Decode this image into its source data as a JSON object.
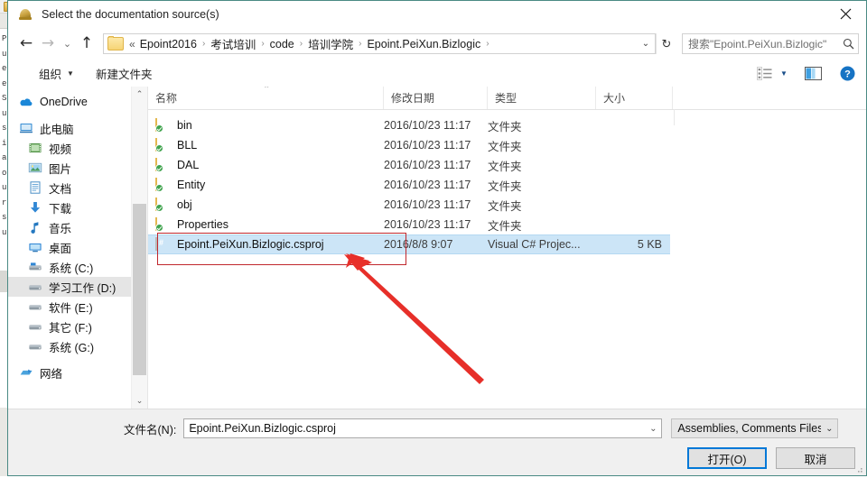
{
  "background_window": {
    "code_fragments": [
      "Pr",
      "ui",
      "el",
      "el",
      "S",
      "ur",
      "si",
      "is",
      "at",
      "or",
      "u",
      "ra",
      "se",
      "ui"
    ]
  },
  "dialog": {
    "title": "Select the documentation source(s)",
    "title_icon": "bell-icon",
    "close_label": "✕"
  },
  "navbar": {
    "back_label": "←",
    "forward_label": "→",
    "recent_label": "⌄",
    "up_label": "↑",
    "address": {
      "folder_icon": "folder-icon",
      "root_label": "«",
      "crumbs": [
        {
          "label": "Epoint2016"
        },
        {
          "label": "考试培训"
        },
        {
          "label": "code"
        },
        {
          "label": "培训学院"
        },
        {
          "label": "Epoint.PeiXun.Bizlogic"
        }
      ],
      "separator": "›",
      "dropdown_label": "⌄",
      "refresh_label": "↻"
    },
    "search": {
      "placeholder": "搜索\"Epoint.PeiXun.Bizlogic\"",
      "icon": "search-icon"
    }
  },
  "toolbar": {
    "organize_label": "组织",
    "organize_caret": "▼",
    "new_folder_label": "新建文件夹",
    "view_icon": "list-view-icon",
    "view_caret": "▼",
    "preview_pane_icon": "preview-pane-icon",
    "help_icon": "help-icon",
    "help_glyph": "?"
  },
  "sidebar": {
    "items": [
      {
        "label": "OneDrive",
        "icon": "onedrive-cloud-icon",
        "indent": false,
        "selected": false
      },
      {
        "label": "此电脑",
        "icon": "this-pc-icon",
        "indent": false,
        "selected": false
      },
      {
        "label": "视频",
        "icon": "videos-icon",
        "indent": true,
        "selected": false
      },
      {
        "label": "图片",
        "icon": "pictures-icon",
        "indent": true,
        "selected": false
      },
      {
        "label": "文档",
        "icon": "documents-icon",
        "indent": true,
        "selected": false
      },
      {
        "label": "下载",
        "icon": "downloads-icon",
        "indent": true,
        "selected": false
      },
      {
        "label": "音乐",
        "icon": "music-icon",
        "indent": true,
        "selected": false
      },
      {
        "label": "桌面",
        "icon": "desktop-icon",
        "indent": true,
        "selected": false
      },
      {
        "label": "系统 (C:)",
        "icon": "drive-system-icon",
        "indent": true,
        "selected": false
      },
      {
        "label": "学习工作 (D:)",
        "icon": "drive-icon",
        "indent": true,
        "selected": true
      },
      {
        "label": "软件 (E:)",
        "icon": "drive-icon",
        "indent": true,
        "selected": false
      },
      {
        "label": "其它 (F:)",
        "icon": "drive-icon",
        "indent": true,
        "selected": false
      },
      {
        "label": "系统 (G:)",
        "icon": "drive-icon",
        "indent": true,
        "selected": false
      },
      {
        "label": "网络",
        "icon": "network-icon",
        "indent": false,
        "selected": false
      }
    ],
    "scroll_up": "⌃",
    "scroll_down": "⌄"
  },
  "filelist": {
    "columns": [
      {
        "key": "name",
        "label": "名称"
      },
      {
        "key": "date",
        "label": "修改日期"
      },
      {
        "key": "type",
        "label": "类型"
      },
      {
        "key": "size",
        "label": "大小"
      }
    ],
    "sort_indicator": "⌃",
    "rows": [
      {
        "name": "bin",
        "date": "2016/10/23 11:17",
        "type": "文件夹",
        "size": "",
        "icon": "folder-icon",
        "selected": false
      },
      {
        "name": "BLL",
        "date": "2016/10/23 11:17",
        "type": "文件夹",
        "size": "",
        "icon": "folder-icon",
        "selected": false
      },
      {
        "name": "DAL",
        "date": "2016/10/23 11:17",
        "type": "文件夹",
        "size": "",
        "icon": "folder-icon",
        "selected": false
      },
      {
        "name": "Entity",
        "date": "2016/10/23 11:17",
        "type": "文件夹",
        "size": "",
        "icon": "folder-icon",
        "selected": false
      },
      {
        "name": "obj",
        "date": "2016/10/23 11:17",
        "type": "文件夹",
        "size": "",
        "icon": "folder-icon",
        "selected": false
      },
      {
        "name": "Properties",
        "date": "2016/10/23 11:17",
        "type": "文件夹",
        "size": "",
        "icon": "folder-icon",
        "selected": false
      },
      {
        "name": "Epoint.PeiXun.Bizlogic.csproj",
        "date": "2016/8/8 9:07",
        "type": "Visual C# Projec...",
        "size": "5 KB",
        "icon": "csproj-icon",
        "selected": true
      }
    ]
  },
  "bottom": {
    "filename_label": "文件名(N):",
    "filename_value": "Epoint.PeiXun.Bizlogic.csproj",
    "filename_caret": "⌄",
    "filter_value": "Assemblies, Comments Files",
    "filter_caret": "⌄",
    "open_button": "打开(O)",
    "cancel_button": "取消"
  },
  "annotations": {
    "highlight_color": "#c0272d",
    "arrow_color": "#e8302a"
  }
}
